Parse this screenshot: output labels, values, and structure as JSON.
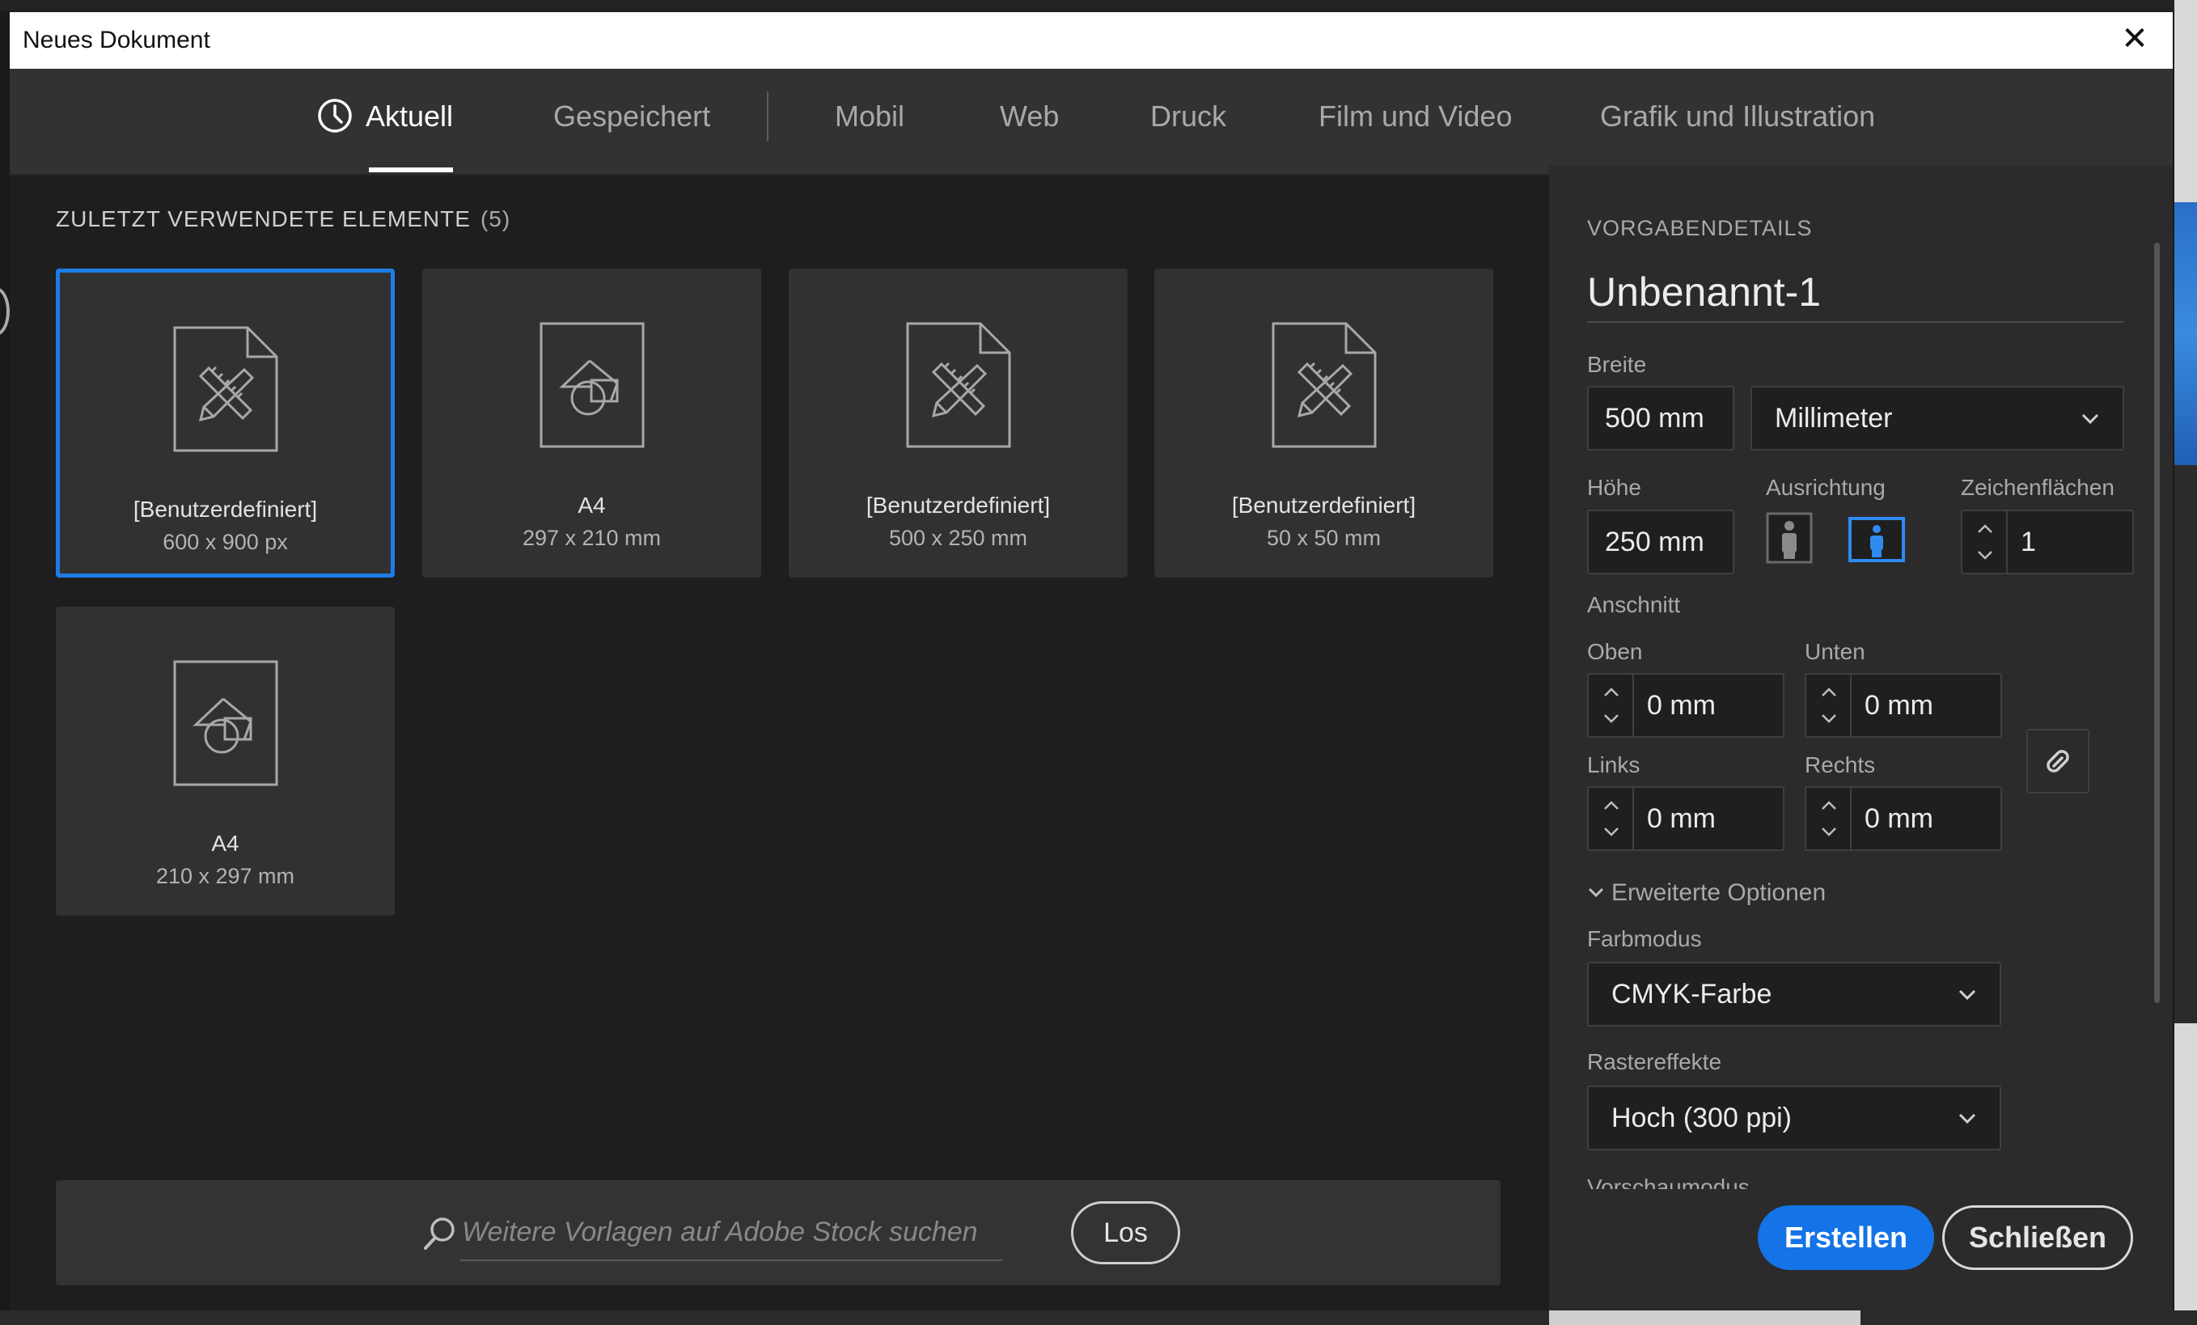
{
  "dialog": {
    "title": "Neues Dokument",
    "close_glyph": "✕"
  },
  "tabs": [
    {
      "label": "Aktuell",
      "active": true,
      "icon": "clock-icon"
    },
    {
      "label": "Gespeichert"
    },
    {
      "label": "Mobil"
    },
    {
      "label": "Web"
    },
    {
      "label": "Druck"
    },
    {
      "label": "Film und Video"
    },
    {
      "label": "Grafik und Illustration"
    }
  ],
  "recent": {
    "heading": "ZULETZT VERWENDETE ELEMENTE",
    "count": "(5)",
    "items": [
      {
        "name": "[Benutzerdefiniert]",
        "dims": "600 x 900 px",
        "icon": "custom-document-icon",
        "selected": true
      },
      {
        "name": "A4",
        "dims": "297 x 210 mm",
        "icon": "shapes-document-icon"
      },
      {
        "name": "[Benutzerdefiniert]",
        "dims": "500 x 250 mm",
        "icon": "custom-document-icon"
      },
      {
        "name": "[Benutzerdefiniert]",
        "dims": "50 x 50 mm",
        "icon": "custom-document-icon"
      },
      {
        "name": "A4",
        "dims": "210 x 297 mm",
        "icon": "shapes-document-icon"
      }
    ]
  },
  "search": {
    "placeholder": "Weitere Vorlagen auf Adobe Stock suchen",
    "go_label": "Los"
  },
  "preset": {
    "heading": "VORGABENDETAILS",
    "name": "Unbenannt-1",
    "width_label": "Breite",
    "width_value": "500 mm",
    "unit": "Millimeter",
    "height_label": "Höhe",
    "height_value": "250 mm",
    "orientation_label": "Ausrichtung",
    "orientation_selected": "landscape",
    "artboards_label": "Zeichenflächen",
    "artboards_value": "1",
    "bleed_label": "Anschnitt",
    "bleed": {
      "top_label": "Oben",
      "top_value": "0 mm",
      "bottom_label": "Unten",
      "bottom_value": "0 mm",
      "left_label": "Links",
      "left_value": "0 mm",
      "right_label": "Rechts",
      "right_value": "0 mm"
    },
    "advanced_label": "Erweiterte Optionen",
    "color_mode_label": "Farbmodus",
    "color_mode_value": "CMYK-Farbe",
    "raster_label": "Rastereffekte",
    "raster_value": "Hoch (300 ppi)",
    "preview_label": "Vorschaumodus"
  },
  "actions": {
    "create": "Erstellen",
    "close": "Schließen"
  },
  "colors": {
    "accent": "#1473e6",
    "selected_border": "#1e7ce5",
    "panel_bg": "#2b2b2b",
    "dialog_bg": "#1e1e1e"
  }
}
